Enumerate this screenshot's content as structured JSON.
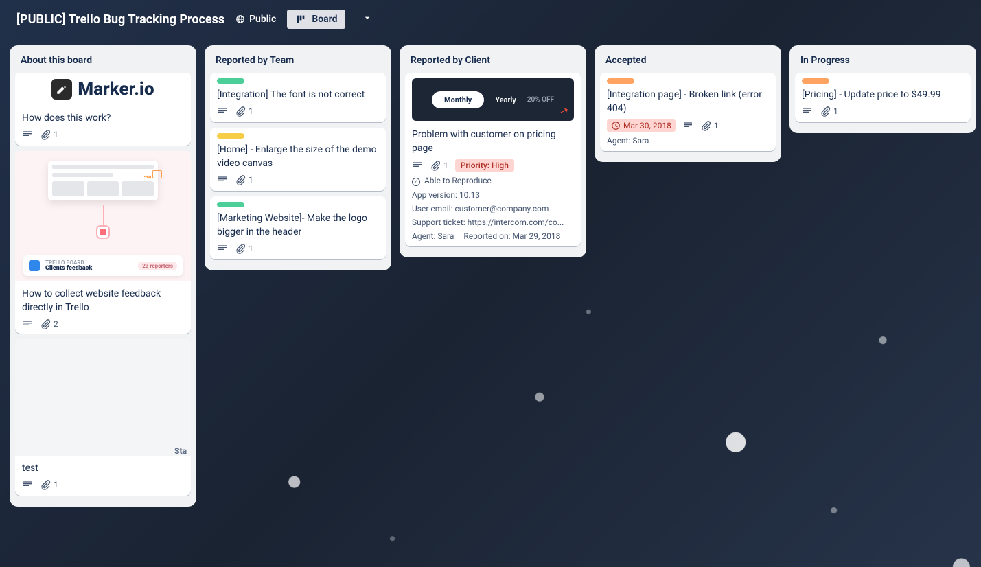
{
  "header": {
    "title": "[PUBLIC] Trello Bug Tracking Process",
    "visibility": "Public",
    "view_button": "Board"
  },
  "lists": [
    {
      "title": "About this board",
      "cards": [
        {
          "cover": "marker",
          "logo_text": "Marker.io",
          "title": "How does this work?",
          "attachments": "1"
        },
        {
          "cover": "diagram",
          "diagram_board_label": "TRELLO BOARD",
          "diagram_board_name": "Clients feedback",
          "diagram_reporters": "23 reporters",
          "title": "How to collect website feedback directly in Trello",
          "attachments": "2"
        },
        {
          "cover": "blank",
          "cover_text": "Sta",
          "title": "test",
          "attachments": "1"
        }
      ]
    },
    {
      "title": "Reported by Team",
      "cards": [
        {
          "label": "green",
          "title": "[Integration] The font is not correct",
          "attachments": "1"
        },
        {
          "label": "yellow",
          "title": "[Home] - Enlarge the size of the demo video canvas",
          "attachments": "1"
        },
        {
          "label": "green",
          "title": "[Marketing Website]- Make the logo bigger in the header",
          "attachments": "1"
        }
      ]
    },
    {
      "title": "Reported by Client",
      "cards": [
        {
          "cover": "pricing",
          "pill": "Monthly",
          "yearly": "Yearly",
          "off": "20% OFF",
          "title": "Problem with customer on pricing page",
          "attachments": "1",
          "priority": "Priority: High",
          "reproduce": "Able to Reproduce",
          "fields": [
            "App version: 10.13",
            "User email: customer@company.com",
            "Support ticket: https://intercom.com/co..."
          ],
          "agent": "Agent: Sara",
          "reported": "Reported on: Mar 29, 2018"
        }
      ]
    },
    {
      "title": "Accepted",
      "cards": [
        {
          "label": "orange",
          "title": "[Integration page] - Broken link (error 404)",
          "due": "Mar 30, 2018",
          "attachments": "1",
          "agent": "Agent: Sara"
        }
      ]
    },
    {
      "title": "In Progress",
      "cards": [
        {
          "label": "orange",
          "title": "[Pricing] - Update price to $49.99",
          "attachments": "1"
        }
      ]
    }
  ]
}
